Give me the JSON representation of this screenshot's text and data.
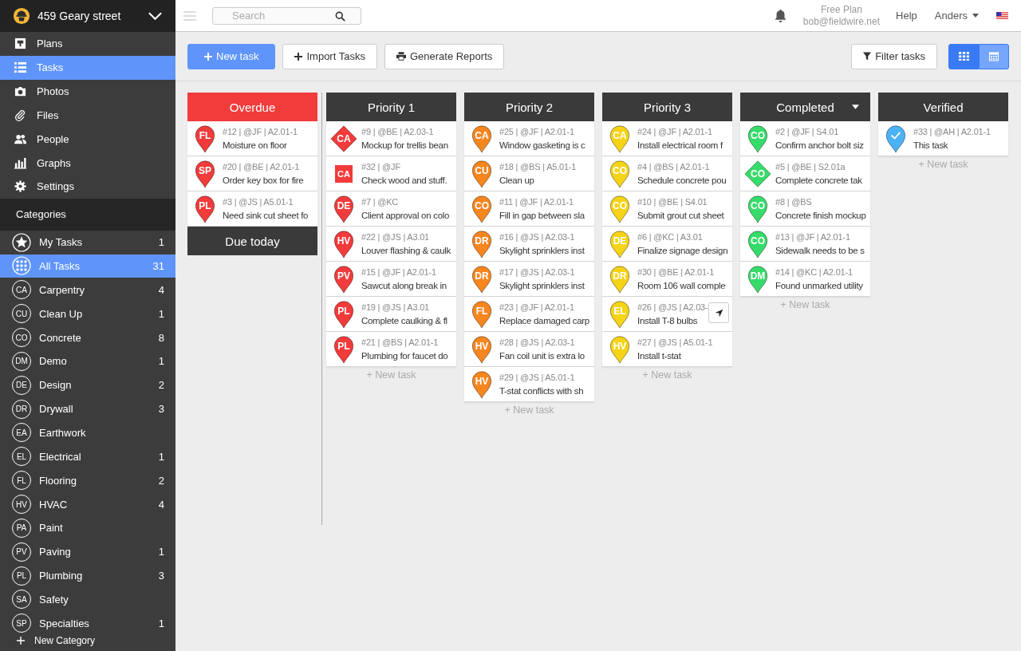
{
  "project": {
    "name": "459 Geary street"
  },
  "nav": [
    {
      "kind": "plans",
      "label": "Plans",
      "selected": false
    },
    {
      "kind": "tasks",
      "label": "Tasks",
      "selected": true
    },
    {
      "kind": "photos",
      "label": "Photos",
      "selected": false
    },
    {
      "kind": "files",
      "label": "Files",
      "selected": false
    },
    {
      "kind": "people",
      "label": "People",
      "selected": false
    },
    {
      "kind": "graphs",
      "label": "Graphs",
      "selected": false
    },
    {
      "kind": "settings",
      "label": "Settings",
      "selected": false
    }
  ],
  "categories": {
    "title": "Categories",
    "items": [
      {
        "kind": "star",
        "label": "My Tasks",
        "count": "1",
        "selected": false
      },
      {
        "kind": "grid",
        "label": "All Tasks",
        "count": "31",
        "selected": true
      },
      {
        "kind": "abbr",
        "abbr": "CA",
        "label": "Carpentry",
        "count": "4",
        "selected": false
      },
      {
        "kind": "abbr",
        "abbr": "CU",
        "label": "Clean Up",
        "count": "1",
        "selected": false
      },
      {
        "kind": "abbr",
        "abbr": "CO",
        "label": "Concrete",
        "count": "8",
        "selected": false
      },
      {
        "kind": "abbr",
        "abbr": "DM",
        "label": "Demo",
        "count": "1",
        "selected": false
      },
      {
        "kind": "abbr",
        "abbr": "DE",
        "label": "Design",
        "count": "2",
        "selected": false
      },
      {
        "kind": "abbr",
        "abbr": "DR",
        "label": "Drywall",
        "count": "3",
        "selected": false
      },
      {
        "kind": "abbr",
        "abbr": "EA",
        "label": "Earthwork",
        "selected": false
      },
      {
        "kind": "abbr",
        "abbr": "EL",
        "label": "Electrical",
        "count": "1",
        "selected": false
      },
      {
        "kind": "abbr",
        "abbr": "FL",
        "label": "Flooring",
        "count": "2",
        "selected": false
      },
      {
        "kind": "abbr",
        "abbr": "HV",
        "label": "HVAC",
        "count": "4",
        "selected": false
      },
      {
        "kind": "abbr",
        "abbr": "PA",
        "label": "Paint",
        "selected": false
      },
      {
        "kind": "abbr",
        "abbr": "PV",
        "label": "Paving",
        "count": "1",
        "selected": false
      },
      {
        "kind": "abbr",
        "abbr": "PL",
        "label": "Plumbing",
        "count": "3",
        "selected": false
      },
      {
        "kind": "abbr",
        "abbr": "SA",
        "label": "Safety",
        "selected": false
      },
      {
        "kind": "abbr",
        "abbr": "SP",
        "label": "Specialties",
        "count": "1",
        "selected": false
      }
    ],
    "new_label": "New Category"
  },
  "topbar": {
    "search": {
      "placeholder": "Search"
    },
    "plan": "Free Plan",
    "email": "bob@fieldwire.net",
    "help": "Help",
    "user": "Anders"
  },
  "actions": {
    "new_task": "New task",
    "import": "Import Tasks",
    "reports": "Generate Reports",
    "filter": "Filter tasks",
    "views": [
      {
        "kind": "grid",
        "selected": true
      },
      {
        "kind": "calendar",
        "selected": false
      }
    ]
  },
  "overdue": {
    "title": "Overdue",
    "color": "#f23b3b",
    "tasks": [
      {
        "badge": "FL",
        "kind": "pin",
        "meta": "#12 | @JF | A2.01-1",
        "title": "Moisture on floor",
        "hover": false
      },
      {
        "badge": "SP",
        "kind": "pin",
        "meta": "#20 | @BE | A2.01-1",
        "title": "Order key box for fire",
        "hover": false
      },
      {
        "badge": "PL",
        "kind": "pin",
        "meta": "#3 | @JS | A5.01-1",
        "title": "Need sink cut sheet fo",
        "hover": false
      }
    ]
  },
  "due_today": {
    "title": "Due today"
  },
  "lanes": [
    {
      "title": "Priority 1",
      "color": "#f23b3b",
      "menu": false,
      "new_task": "+ New task",
      "tasks": [
        {
          "badge": "CA",
          "kind": "diamond",
          "meta": "#9 | @BE | A2.03-1",
          "title": "Mockup for trellis bean",
          "hover": false
        },
        {
          "badge": "CA",
          "kind": "square",
          "meta": "#32 | @JF",
          "title": "Check wood and stuff.",
          "hover": false
        },
        {
          "badge": "DE",
          "kind": "pin",
          "meta": "#7 | @KC",
          "title": "Client approval on colo",
          "hover": false
        },
        {
          "badge": "HV",
          "kind": "pin",
          "meta": "#22 | @JS | A3.01",
          "title": "Louver flashing & caulk",
          "hover": false
        },
        {
          "badge": "PV",
          "kind": "pin",
          "meta": "#15 | @JF | A2.01-1",
          "title": "Sawcut along break in",
          "hover": false
        },
        {
          "badge": "PL",
          "kind": "pin",
          "meta": "#19 | @JS | A3.01",
          "title": "Complete caulking & fl",
          "hover": false
        },
        {
          "badge": "PL",
          "kind": "pin",
          "meta": "#21 | @BS | A2.01-1",
          "title": "Plumbing for faucet do",
          "hover": false
        }
      ]
    },
    {
      "title": "Priority 2",
      "color": "#f7861f",
      "menu": false,
      "new_task": "+ New task",
      "tasks": [
        {
          "badge": "CA",
          "kind": "pin",
          "meta": "#25 | @JF | A2.01-1",
          "title": "Window gasketing is c",
          "hover": false
        },
        {
          "badge": "CU",
          "kind": "pin",
          "meta": "#18 | @BS | A5.01-1",
          "title": "Clean up",
          "hover": false
        },
        {
          "badge": "CO",
          "kind": "pin",
          "meta": "#11 | @JF | A2.01-1",
          "title": "Fill in gap between sla",
          "hover": false
        },
        {
          "badge": "DR",
          "kind": "pin",
          "meta": "#16 | @JS | A2.03-1",
          "title": "Skylight sprinklers inst",
          "hover": false
        },
        {
          "badge": "DR",
          "kind": "pin",
          "meta": "#17 | @JS | A2.03-1",
          "title": "Skylight sprinklers inst",
          "hover": false
        },
        {
          "badge": "FL",
          "kind": "pin",
          "meta": "#23 | @JF | A2.01-1",
          "title": "Replace damaged carp",
          "hover": false
        },
        {
          "badge": "HV",
          "kind": "pin",
          "meta": "#28 | @JS | A2.03-1",
          "title": "Fan coil unit is extra lo",
          "hover": false
        },
        {
          "badge": "HV",
          "kind": "pin",
          "meta": "#29 | @JS | A5.01-1",
          "title": "T-stat conflicts with sh",
          "hover": false
        }
      ]
    },
    {
      "title": "Priority 3",
      "color": "#f5d316",
      "menu": false,
      "new_task": "+ New task",
      "tasks": [
        {
          "badge": "CA",
          "kind": "pin",
          "meta": "#24 | @JF | A2.01-1",
          "title": "Install electrical room f",
          "hover": false
        },
        {
          "badge": "CO",
          "kind": "pin",
          "meta": "#4 | @BS | A2.01-1",
          "title": "Schedule concrete pou",
          "hover": false
        },
        {
          "badge": "CO",
          "kind": "pin",
          "meta": "#10 | @BE | S4.01",
          "title": "Submit grout cut sheet",
          "hover": false
        },
        {
          "badge": "DE",
          "kind": "pin",
          "meta": "#6 | @KC | A3.01",
          "title": "Finalize signage design",
          "hover": false
        },
        {
          "badge": "DR",
          "kind": "pin",
          "meta": "#30 | @BE | A2.01-1",
          "title": "Room 106 wall comple",
          "hover": false
        },
        {
          "badge": "EL",
          "kind": "pin",
          "meta": "#26 | @JS | A2.03-",
          "title": "Install T-8 bulbs",
          "hover": true
        },
        {
          "badge": "HV",
          "kind": "pin",
          "meta": "#27 | @JS | A5.01-1",
          "title": "Install t-stat",
          "hover": false
        }
      ]
    },
    {
      "title": "Completed",
      "color": "#36dc6a",
      "menu": true,
      "new_task": "+ New task",
      "tasks": [
        {
          "badge": "CO",
          "kind": "pin",
          "meta": "#2 | @JF | S4.01",
          "title": "Confirm anchor bolt siz",
          "hover": false
        },
        {
          "badge": "CO",
          "kind": "diamond",
          "meta": "#5 | @BE | S2.01a",
          "title": "Complete concrete tak",
          "hover": false
        },
        {
          "badge": "CO",
          "kind": "pin",
          "meta": "#8 | @BS",
          "title": "Concrete finish mockup",
          "hover": false
        },
        {
          "badge": "CO",
          "kind": "pin",
          "meta": "#13 | @JF | A2.01-1",
          "title": "Sidewalk needs to be s",
          "hover": false
        },
        {
          "badge": "DM",
          "kind": "pin",
          "meta": "#14 | @KC | A2.01-1",
          "title": "Found unmarked utility",
          "hover": false
        }
      ]
    },
    {
      "title": "Verified",
      "color": "#4cb2f6",
      "menu": false,
      "new_task": "+ New task",
      "tasks": [
        {
          "kind": "check-pin",
          "meta": "#33 | @AH | A2.01-1",
          "title": "This task",
          "hover": false
        }
      ]
    }
  ]
}
